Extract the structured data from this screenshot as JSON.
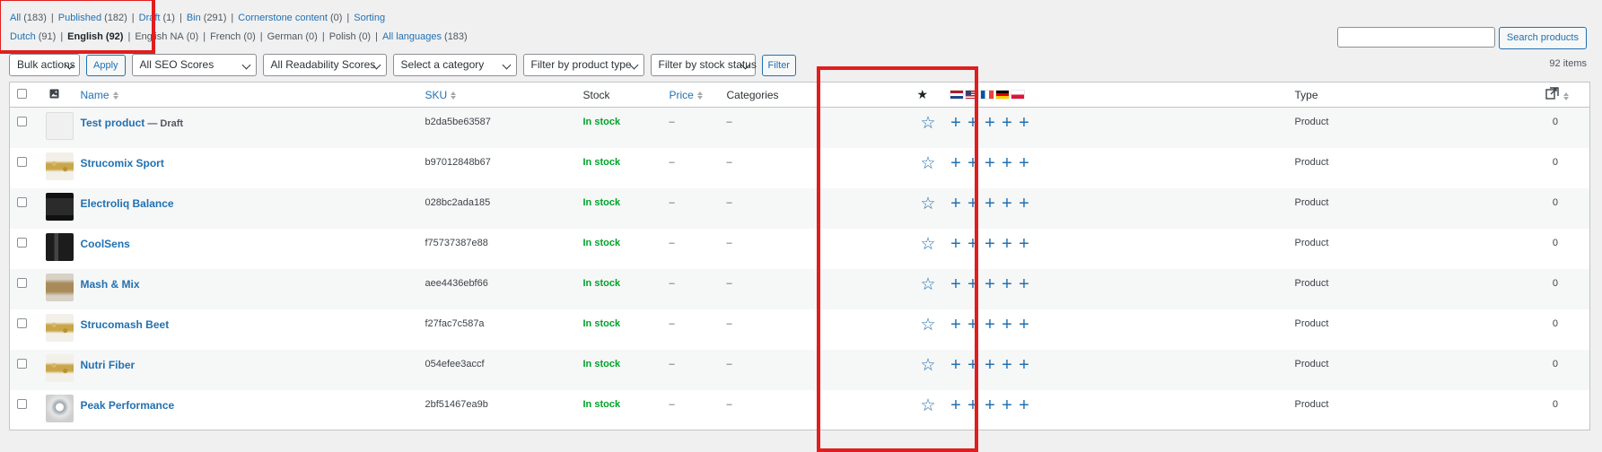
{
  "status_links": [
    {
      "label": "All",
      "count": "(183)"
    },
    {
      "label": "Published",
      "count": "(182)"
    },
    {
      "label": "Draft",
      "count": "(1)"
    },
    {
      "label": "Bin",
      "count": "(291)"
    },
    {
      "label": "Cornerstone content",
      "count": "(0)"
    },
    {
      "label": "Sorting",
      "count": ""
    }
  ],
  "language_links": [
    {
      "label": "Dutch",
      "count": "(91)",
      "type": "link"
    },
    {
      "label": "English",
      "count": "(92)",
      "type": "current"
    },
    {
      "label": "English NA",
      "count": "(0)",
      "type": "plain"
    },
    {
      "label": "French",
      "count": "(0)",
      "type": "plain"
    },
    {
      "label": "German",
      "count": "(0)",
      "type": "plain"
    },
    {
      "label": "Polish",
      "count": "(0)",
      "type": "plain"
    },
    {
      "label": "All languages",
      "count": "(183)",
      "type": "link"
    }
  ],
  "search": {
    "placeholder": "",
    "value": "",
    "button": "Search products"
  },
  "filters": {
    "bulk_actions": "Bulk actions",
    "apply": "Apply",
    "seo": "All SEO Scores",
    "readability": "All Readability Scores",
    "category": "Select a category",
    "product_type": "Filter by product type",
    "stock_status": "Filter by stock status",
    "filter_button": "Filter"
  },
  "items_count": "92 items",
  "columns": {
    "name": "Name",
    "sku": "SKU",
    "stock": "Stock",
    "price": "Price",
    "categories": "Categories",
    "type": "Type"
  },
  "flags": [
    {
      "name": "netherlands-flag",
      "colors": [
        "#ae1c28",
        "#ffffff",
        "#21468b"
      ],
      "dir": "h"
    },
    {
      "name": "usa-flag",
      "colors": [
        "#b22234",
        "#ffffff",
        "#3c3b6e"
      ],
      "dir": "us"
    },
    {
      "name": "france-flag",
      "colors": [
        "#0055a4",
        "#ffffff",
        "#ef4135"
      ],
      "dir": "v"
    },
    {
      "name": "germany-flag",
      "colors": [
        "#000000",
        "#dd0000",
        "#ffce00"
      ],
      "dir": "h"
    },
    {
      "name": "poland-flag",
      "colors": [
        "#ffffff",
        "#dc143c"
      ],
      "dir": "h2"
    }
  ],
  "rows": [
    {
      "name": "Test product",
      "state": "— Draft",
      "sku": "b2da5be63587",
      "stock": "In stock",
      "price": "–",
      "categories": "–",
      "type": "Product",
      "count": "0",
      "thumb": "placeholder"
    },
    {
      "name": "Strucomix Sport",
      "state": "",
      "sku": "b97012848b67",
      "stock": "In stock",
      "price": "–",
      "categories": "–",
      "type": "Product",
      "count": "0",
      "thumb": "granola"
    },
    {
      "name": "Electroliq Balance",
      "state": "",
      "sku": "028bc2ada185",
      "stock": "In stock",
      "price": "–",
      "categories": "–",
      "type": "Product",
      "count": "0",
      "thumb": "dark"
    },
    {
      "name": "CoolSens",
      "state": "",
      "sku": "f75737387e88",
      "stock": "In stock",
      "price": "–",
      "categories": "–",
      "type": "Product",
      "count": "0",
      "thumb": "bottle"
    },
    {
      "name": "Mash & Mix",
      "state": "",
      "sku": "aee4436ebf66",
      "stock": "In stock",
      "price": "–",
      "categories": "–",
      "type": "Product",
      "count": "0",
      "thumb": "oats"
    },
    {
      "name": "Strucomash Beet",
      "state": "",
      "sku": "f27fac7c587a",
      "stock": "In stock",
      "price": "–",
      "categories": "–",
      "type": "Product",
      "count": "0",
      "thumb": "granola"
    },
    {
      "name": "Nutri Fiber",
      "state": "",
      "sku": "054efee3accf",
      "stock": "In stock",
      "price": "–",
      "categories": "–",
      "type": "Product",
      "count": "0",
      "thumb": "granola"
    },
    {
      "name": "Peak Performance",
      "state": "",
      "sku": "2bf51467ea9b",
      "stock": "In stock",
      "price": "–",
      "categories": "–",
      "type": "Product",
      "count": "0",
      "thumb": "shaker"
    }
  ],
  "colors": {
    "accent": "#2271b1",
    "in_stock": "#00a32a",
    "highlight": "#e11d1d"
  }
}
